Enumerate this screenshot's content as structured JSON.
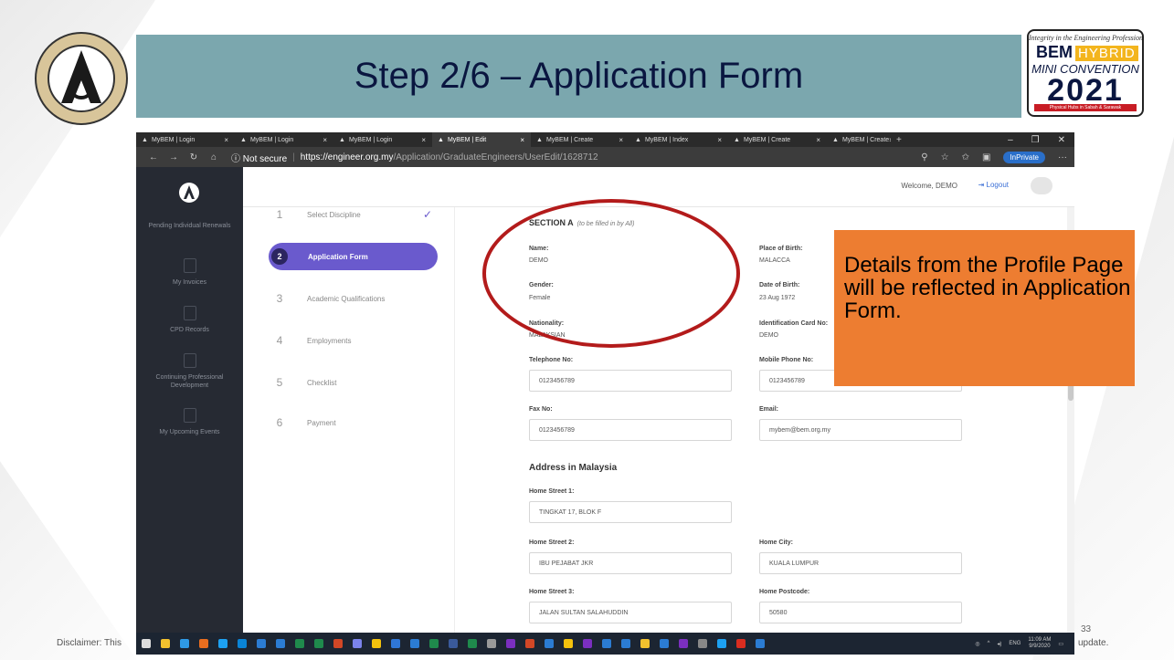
{
  "slide": {
    "title": "Step 2/6 – Application Form",
    "page_number": "33",
    "disclaimer_left": "Disclaimer: This",
    "disclaimer_right": "update."
  },
  "bem_logo": {
    "tagline": "Integrity in the Engineering Profession",
    "bem": "BEM",
    "hybrid": "HYBRID",
    "mini": "MINI CONVENTION",
    "year": "2021",
    "footer": "Physical Hubs in Sabah & Sarawak"
  },
  "callout": {
    "text": "Details from the Profile Page will be reflected in Application Form."
  },
  "browser": {
    "tabs": [
      {
        "label": "MyBEM | Login"
      },
      {
        "label": "MyBEM | Login"
      },
      {
        "label": "MyBEM | Login"
      },
      {
        "label": "MyBEM | Edit",
        "active": true
      },
      {
        "label": "MyBEM | Create"
      },
      {
        "label": "MyBEM | Index"
      },
      {
        "label": "MyBEM | Create"
      },
      {
        "label": "MyBEM | Create"
      }
    ],
    "not_secure": "Not secure",
    "url_host": "https://engineer.org.my",
    "url_path": "/Application/GraduateEngineers/UserEdit/1628712",
    "inprivate": "InPrivate"
  },
  "sidebar": {
    "items": [
      {
        "label": "Pending Individual Renewals"
      },
      {
        "label": "My Invoices"
      },
      {
        "label": "CPD Records"
      },
      {
        "label": "Continuing Professional Development"
      },
      {
        "label": "My Upcoming Events"
      }
    ]
  },
  "topbar": {
    "welcome": "Welcome, DEMO",
    "logout": "Logout"
  },
  "steps": [
    {
      "num": "1",
      "label": "Select Discipline"
    },
    {
      "num": "2",
      "label": "Application Form"
    },
    {
      "num": "3",
      "label": "Academic Qualifications"
    },
    {
      "num": "4",
      "label": "Employments"
    },
    {
      "num": "5",
      "label": "Checklist"
    },
    {
      "num": "6",
      "label": "Payment"
    }
  ],
  "form": {
    "section_title": "SECTION A",
    "section_note": "(to be filled in by All)",
    "name_label": "Name:",
    "name_value": "DEMO",
    "pob_label": "Place of Birth:",
    "pob_value": "MALACCA",
    "gender_label": "Gender:",
    "gender_value": "Female",
    "dob_label": "Date of Birth:",
    "dob_value": "23 Aug 1972",
    "nationality_label": "Nationality:",
    "nationality_value": "MALAYSIAN",
    "ic_label": "Identification Card No:",
    "ic_value": "DEMO",
    "tel_label": "Telephone No:",
    "tel_value": "0123456789",
    "mobile_label": "Mobile Phone No:",
    "mobile_value": "0123456789",
    "fax_label": "Fax No:",
    "fax_value": "0123456789",
    "email_label": "Email:",
    "email_value": "mybem@bem.org.my",
    "address_title": "Address in Malaysia",
    "street1_label": "Home Street 1:",
    "street1_value": "TINGKAT 17, BLOK F",
    "street2_label": "Home Street 2:",
    "street2_value": "IBU PEJABAT JKR",
    "city_label": "Home City:",
    "city_value": "KUALA LUMPUR",
    "street3_label": "Home Street 3:",
    "street3_value": "JALAN SULTAN SALAHUDDIN",
    "postcode_label": "Home Postcode:",
    "postcode_value": "50580"
  },
  "taskbar": {
    "lang": "ENG",
    "time": "11:09 AM",
    "date": "9/9/2020"
  },
  "colors": {
    "title_band": "#7ba7ae",
    "callout": "#ed7d31",
    "ellipse": "#b31b1b",
    "step_active": "#6a5acd",
    "sidebar": "#262a33"
  }
}
